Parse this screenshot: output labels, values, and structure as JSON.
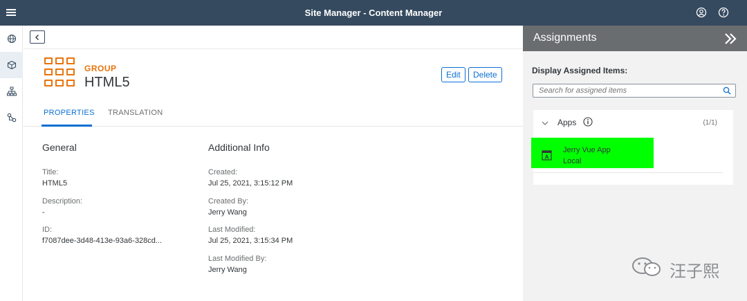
{
  "shell": {
    "title": "Site Manager - Content Manager",
    "bg_color": "#354a5f",
    "icons": [
      "menu-icon",
      "user-icon",
      "help-icon"
    ]
  },
  "rail": {
    "items": [
      {
        "name": "globe-icon",
        "active": false
      },
      {
        "name": "cube-icon",
        "active": true
      },
      {
        "name": "hierarchy-icon",
        "active": false
      },
      {
        "name": "connection-icon",
        "active": false
      }
    ]
  },
  "object": {
    "type": "GROUP",
    "title": "HTML5",
    "accent_color": "#e9730c",
    "edit_label": "Edit",
    "delete_label": "Delete"
  },
  "tabs": [
    {
      "label": "PROPERTIES",
      "active": true
    },
    {
      "label": "TRANSLATION",
      "active": false
    }
  ],
  "general": {
    "heading": "General",
    "fields": [
      {
        "label": "Title:",
        "value": "HTML5"
      },
      {
        "label": "Description:",
        "value": "-"
      },
      {
        "label": "ID:",
        "value": "f7087dee-3d48-413e-93a6-328cd..."
      }
    ]
  },
  "additional": {
    "heading": "Additional Info",
    "fields": [
      {
        "label": "Created:",
        "value": "Jul 25, 2021, 3:15:12 PM"
      },
      {
        "label": "Created By:",
        "value": "Jerry Wang"
      },
      {
        "label": "Last Modified:",
        "value": "Jul 25, 2021, 3:15:34 PM"
      },
      {
        "label": "Last Modified By:",
        "value": "Jerry Wang"
      }
    ]
  },
  "assignments": {
    "title": "Assignments",
    "display_label": "Display Assigned Items:",
    "search_placeholder": "Search for assigned items",
    "apps_group": {
      "label": "Apps",
      "count": "(1/1)",
      "items": [
        {
          "name": "Jerry Vue App",
          "source": "Local",
          "highlight_color": "#00ff00"
        }
      ]
    }
  },
  "watermark": {
    "text": "汪子熙"
  }
}
